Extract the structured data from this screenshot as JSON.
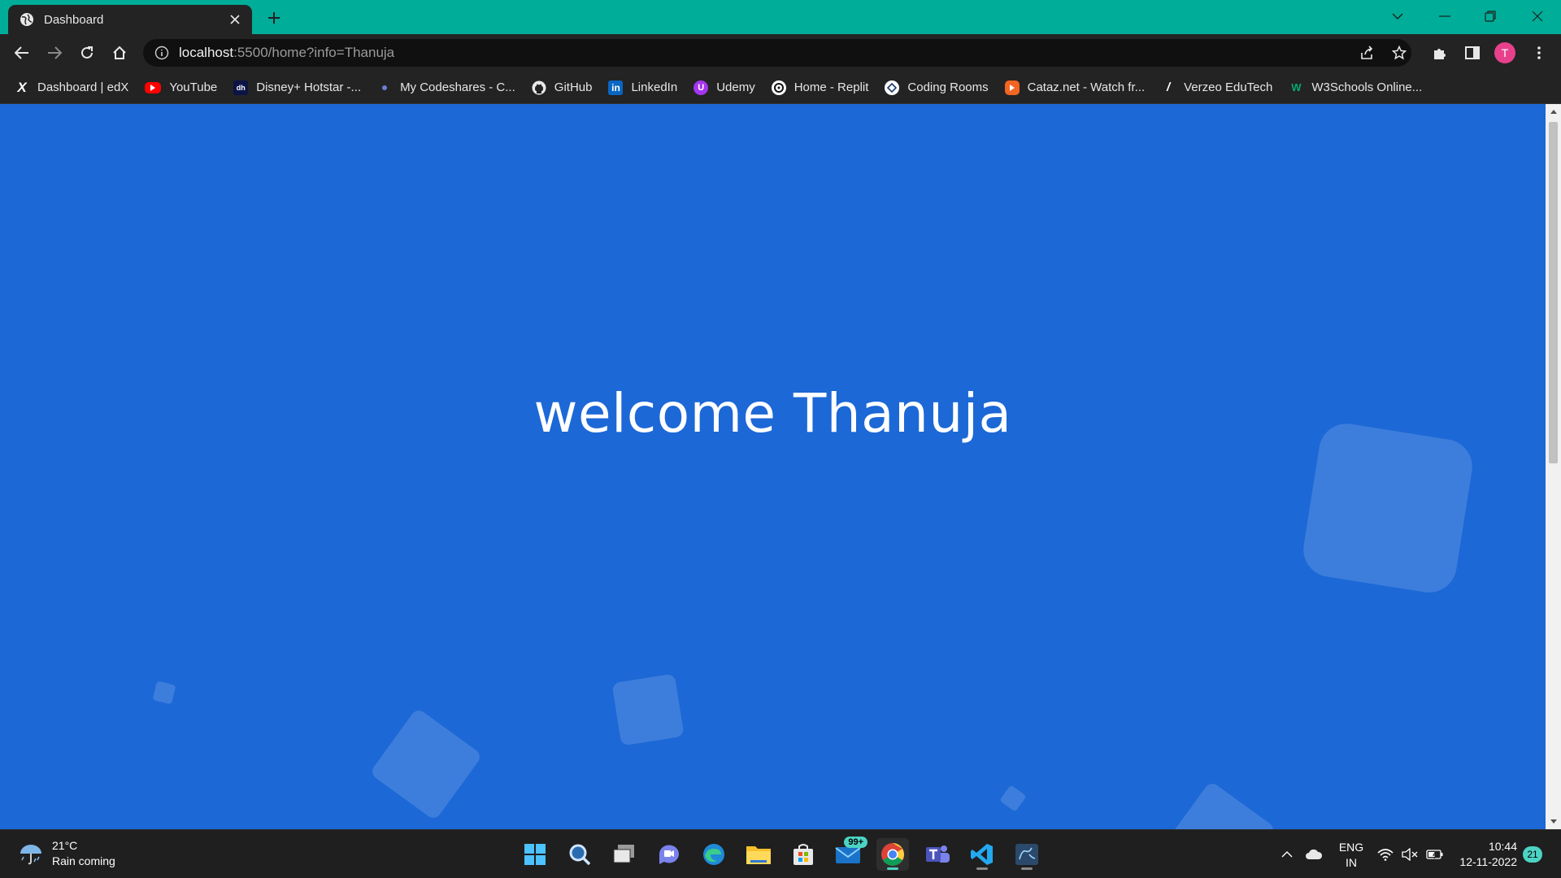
{
  "browser": {
    "tab": {
      "title": "Dashboard",
      "favicon": "globe-icon"
    },
    "url": {
      "host": "localhost",
      "rest": ":5500/home?info=Thanuja"
    },
    "profile_initial": "T",
    "accent_color": "#00ad98"
  },
  "bookmarks": [
    {
      "label": "Dashboard | edX",
      "icon": "edx-icon"
    },
    {
      "label": "YouTube",
      "icon": "youtube-icon"
    },
    {
      "label": "Disney+ Hotstar -...",
      "icon": "hotstar-icon"
    },
    {
      "label": "My Codeshares - C...",
      "icon": "codeshare-icon"
    },
    {
      "label": "GitHub",
      "icon": "github-icon"
    },
    {
      "label": "LinkedIn",
      "icon": "linkedin-icon"
    },
    {
      "label": "Udemy",
      "icon": "udemy-icon"
    },
    {
      "label": "Home - Replit",
      "icon": "replit-icon"
    },
    {
      "label": "Coding Rooms",
      "icon": "coding-rooms-icon"
    },
    {
      "label": "Cataz.net - Watch fr...",
      "icon": "cataz-icon"
    },
    {
      "label": "Verzeo EduTech",
      "icon": "verzeo-icon"
    },
    {
      "label": "W3Schools Online...",
      "icon": "w3schools-icon"
    }
  ],
  "page": {
    "heading": "welcome Thanuja",
    "background_color": "#1c68d6"
  },
  "taskbar": {
    "weather": {
      "temp": "21°C",
      "condition": "Rain coming"
    },
    "mail_badge": "99+",
    "language": {
      "lang": "ENG",
      "region": "IN"
    },
    "clock": {
      "time": "10:44",
      "date": "12-11-2022"
    },
    "notification_count": "21"
  }
}
